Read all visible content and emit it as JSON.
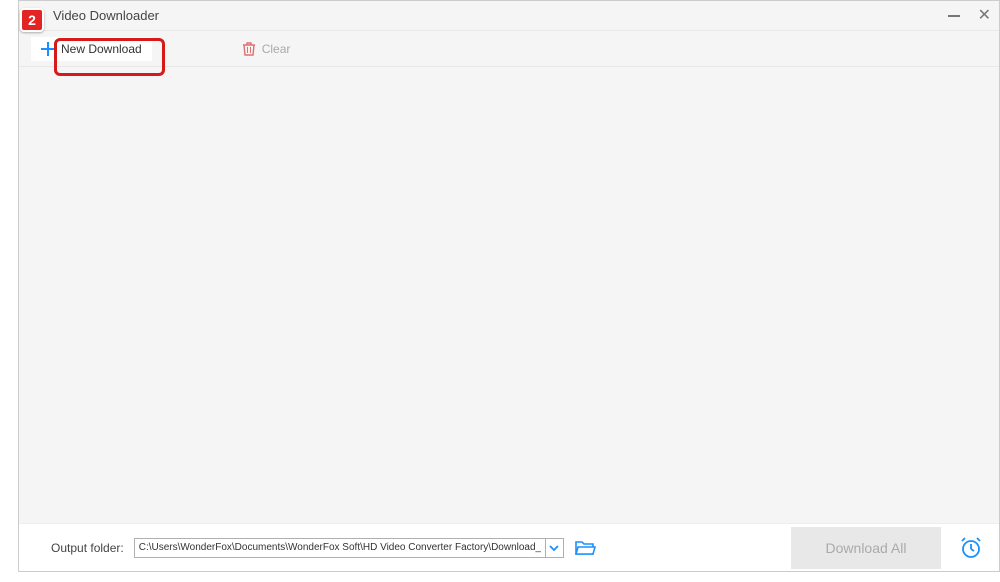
{
  "callout": {
    "number": "2"
  },
  "titlebar": {
    "title": "Video Downloader"
  },
  "toolbar": {
    "new_download_label": "New Download",
    "clear_label": "Clear"
  },
  "bottom": {
    "output_label": "Output folder:",
    "output_path": "C:\\Users\\WonderFox\\Documents\\WonderFox Soft\\HD Video Converter Factory\\Download_Video",
    "download_all_label": "Download All"
  }
}
